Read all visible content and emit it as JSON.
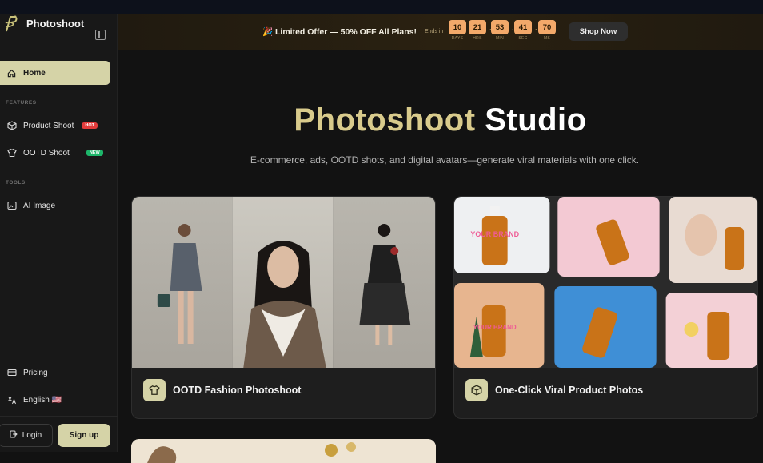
{
  "brand": {
    "name": "Photoshoot"
  },
  "sidebar": {
    "home": "Home",
    "features_label": "FEATURES",
    "product_shoot": {
      "label": "Product Shoot",
      "badge": "HOT"
    },
    "ootd_shoot": {
      "label": "OOTD Shoot",
      "badge": "NEW"
    },
    "tools_label": "TOOLS",
    "ai_image": "AI Image",
    "pricing": "Pricing",
    "language": "English 🇺🇸",
    "login": "Login",
    "signup": "Sign up"
  },
  "promo": {
    "text": "🎉 Limited Offer — 50% OFF All Plans!",
    "ends_in": "Ends in",
    "countdown": [
      {
        "value": "10",
        "label": "DAYS"
      },
      {
        "value": "21",
        "label": "HRS"
      },
      {
        "value": "53",
        "label": "MIN"
      },
      {
        "value": "41",
        "label": "SEC"
      },
      {
        "value": "70",
        "label": "MS"
      }
    ],
    "shop_now": "Shop Now"
  },
  "hero": {
    "title_accent": "Photoshoot",
    "title_rest": "Studio",
    "subtitle": "E-commerce, ads, OOTD shots, and digital avatars—generate viral materials with one click."
  },
  "cards": [
    {
      "title": "OOTD Fashion Photoshoot",
      "icon": "shirt-icon"
    },
    {
      "title": "One-Click Viral Product Photos",
      "icon": "box-icon"
    }
  ],
  "brand_text_on_bottles": "YOUR BRAND",
  "colors": {
    "accent": "#d9cb8c",
    "active_bg": "#d5d3a7",
    "countdown": "#f3a96a",
    "hot": "#e23b3b",
    "new": "#1db66a"
  }
}
